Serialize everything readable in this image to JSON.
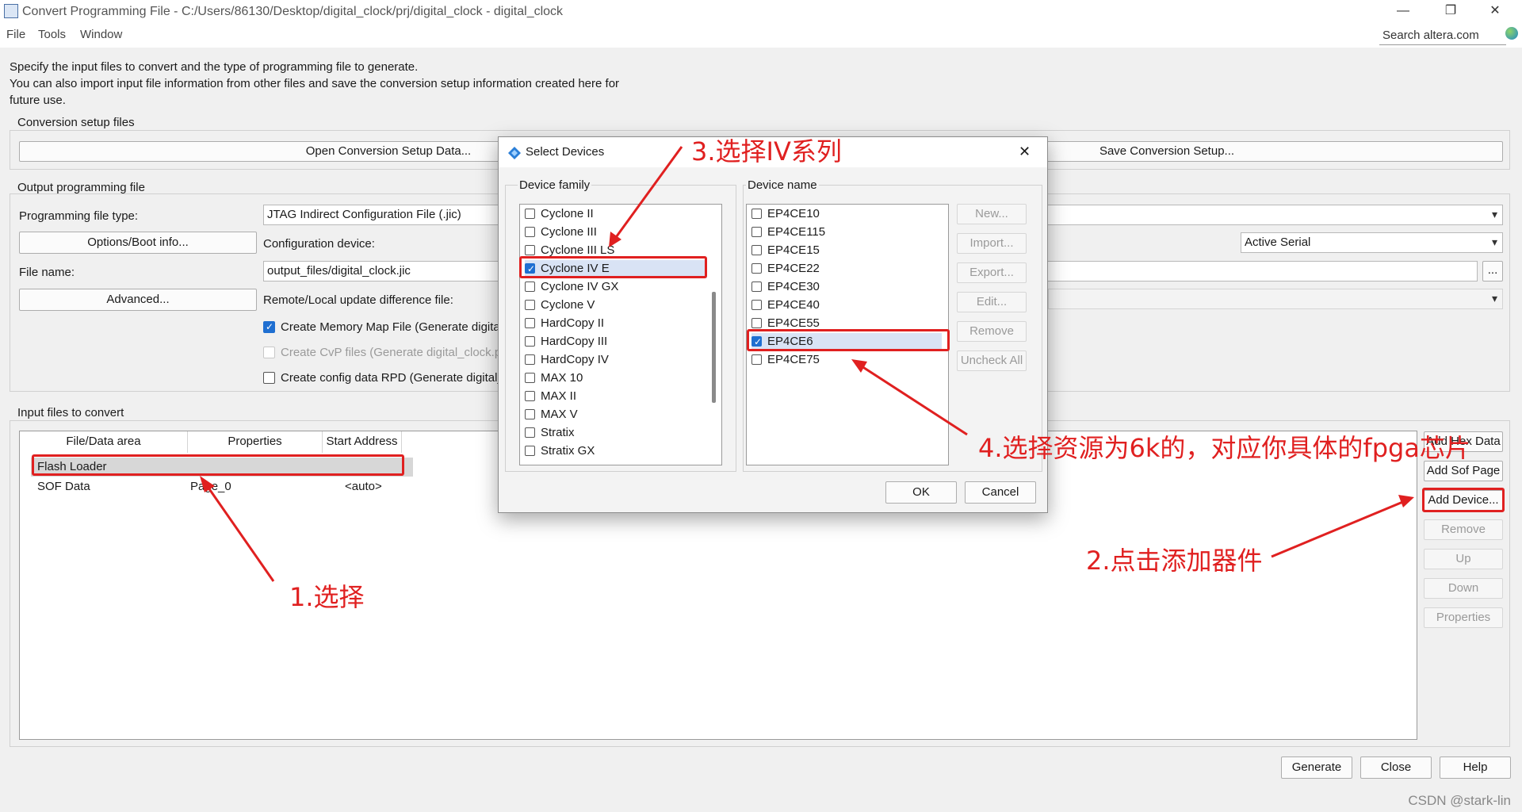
{
  "window": {
    "title": "Convert Programming File - C:/Users/86130/Desktop/digital_clock/prj/digital_clock - digital_clock",
    "minimize": "—",
    "restore": "❐",
    "close": "✕"
  },
  "menu": [
    "File",
    "Tools",
    "Window"
  ],
  "search_placeholder": "Search altera.com",
  "intro": [
    "Specify the input files to convert and the type of programming file to generate.",
    "You can also import input file information from other files and save the conversion setup information created here for",
    "future use."
  ],
  "conversion_setup": {
    "legend": "Conversion setup files",
    "open_button": "Open Conversion Setup Data...",
    "save_button": "Save Conversion Setup..."
  },
  "output_file": {
    "legend": "Output programming file",
    "prog_type_label": "Programming file type:",
    "prog_type_value": "JTAG Indirect Configuration File (.jic)",
    "options_button": "Options/Boot info...",
    "config_device_label": "Configuration device:",
    "mode_value": "Active Serial",
    "file_name_label": "File name:",
    "file_name_value": "output_files/digital_clock.jic",
    "browse": "...",
    "advanced_button": "Advanced...",
    "remote_label": "Remote/Local update difference file:",
    "opt1": "Create Memory Map File (Generate digita",
    "opt2": "Create CvP files (Generate digital_clock.p",
    "opt3": "Create config data RPD (Generate digital_"
  },
  "input_files": {
    "legend": "Input files to convert",
    "columns": [
      "File/Data area",
      "Properties",
      "Start Address"
    ],
    "rows": [
      {
        "area": "Flash Loader",
        "props": "",
        "addr": ""
      },
      {
        "area": "SOF Data",
        "props": "Page_0",
        "addr": "<auto>"
      }
    ],
    "side_buttons": [
      "Add Hex Data",
      "Add Sof Page",
      "Add Device...",
      "Remove",
      "Up",
      "Down",
      "Properties"
    ]
  },
  "bottom_buttons": [
    "Generate",
    "Close",
    "Help"
  ],
  "dialog": {
    "title": "Select Devices",
    "close": "✕",
    "family_legend": "Device family",
    "families": [
      "Cyclone II",
      "Cyclone III",
      "Cyclone III LS",
      "Cyclone IV E",
      "Cyclone IV GX",
      "Cyclone V",
      "HardCopy II",
      "HardCopy III",
      "HardCopy IV",
      "MAX 10",
      "MAX II",
      "MAX V",
      "Stratix",
      "Stratix GX"
    ],
    "device_legend": "Device name",
    "devices": [
      "EP4CE10",
      "EP4CE115",
      "EP4CE15",
      "EP4CE22",
      "EP4CE30",
      "EP4CE40",
      "EP4CE55",
      "EP4CE6",
      "EP4CE75"
    ],
    "side_buttons": [
      "New...",
      "Import...",
      "Export...",
      "Edit...",
      "Remove",
      "Uncheck All"
    ],
    "ok": "OK",
    "cancel": "Cancel"
  },
  "annotations": {
    "step1": "1.选择",
    "step2": "2.点击添加器件",
    "step3": "3.选择IV系列",
    "step4": "4.选择资源为6k的，对应你具体的fpga芯片"
  },
  "watermark": "CSDN @stark-lin",
  "colors": {
    "annotation": "#e02020",
    "checkbox_on": "#1f6fd1"
  }
}
